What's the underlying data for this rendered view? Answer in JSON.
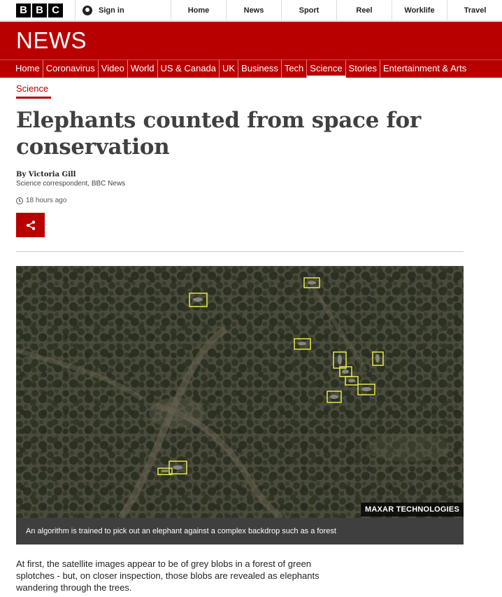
{
  "header": {
    "logo_letters": [
      "B",
      "B",
      "C"
    ],
    "signin_label": "Sign in",
    "nav": [
      "Home",
      "News",
      "Sport",
      "Reel",
      "Worklife",
      "Travel"
    ]
  },
  "news_band": {
    "title": "NEWS",
    "nav": [
      "Home",
      "Coronavirus",
      "Video",
      "World",
      "US & Canada",
      "UK",
      "Business",
      "Tech",
      "Science",
      "Stories",
      "Entertainment & Arts"
    ],
    "active": "Science"
  },
  "article": {
    "section": "Science",
    "headline": "Elephants counted from space for conservation",
    "author": "By Victoria Gill",
    "author_role": "Science correspondent, BBC News",
    "timestamp": "18 hours ago",
    "image_credit": "MAXAR TECHNOLOGIES",
    "image_caption": "An algorithm is trained to pick out an elephant against a complex backdrop such as a forest",
    "body": "At first, the satellite images appear to be of grey blobs in a forest of green splotches - but, on closer inspection, those blobs are revealed as elephants wandering through the trees."
  },
  "colors": {
    "brand_red": "#b80000",
    "detection_box": "#e8e84a"
  },
  "icons": [
    "user-icon",
    "share-icon",
    "clock-icon"
  ]
}
